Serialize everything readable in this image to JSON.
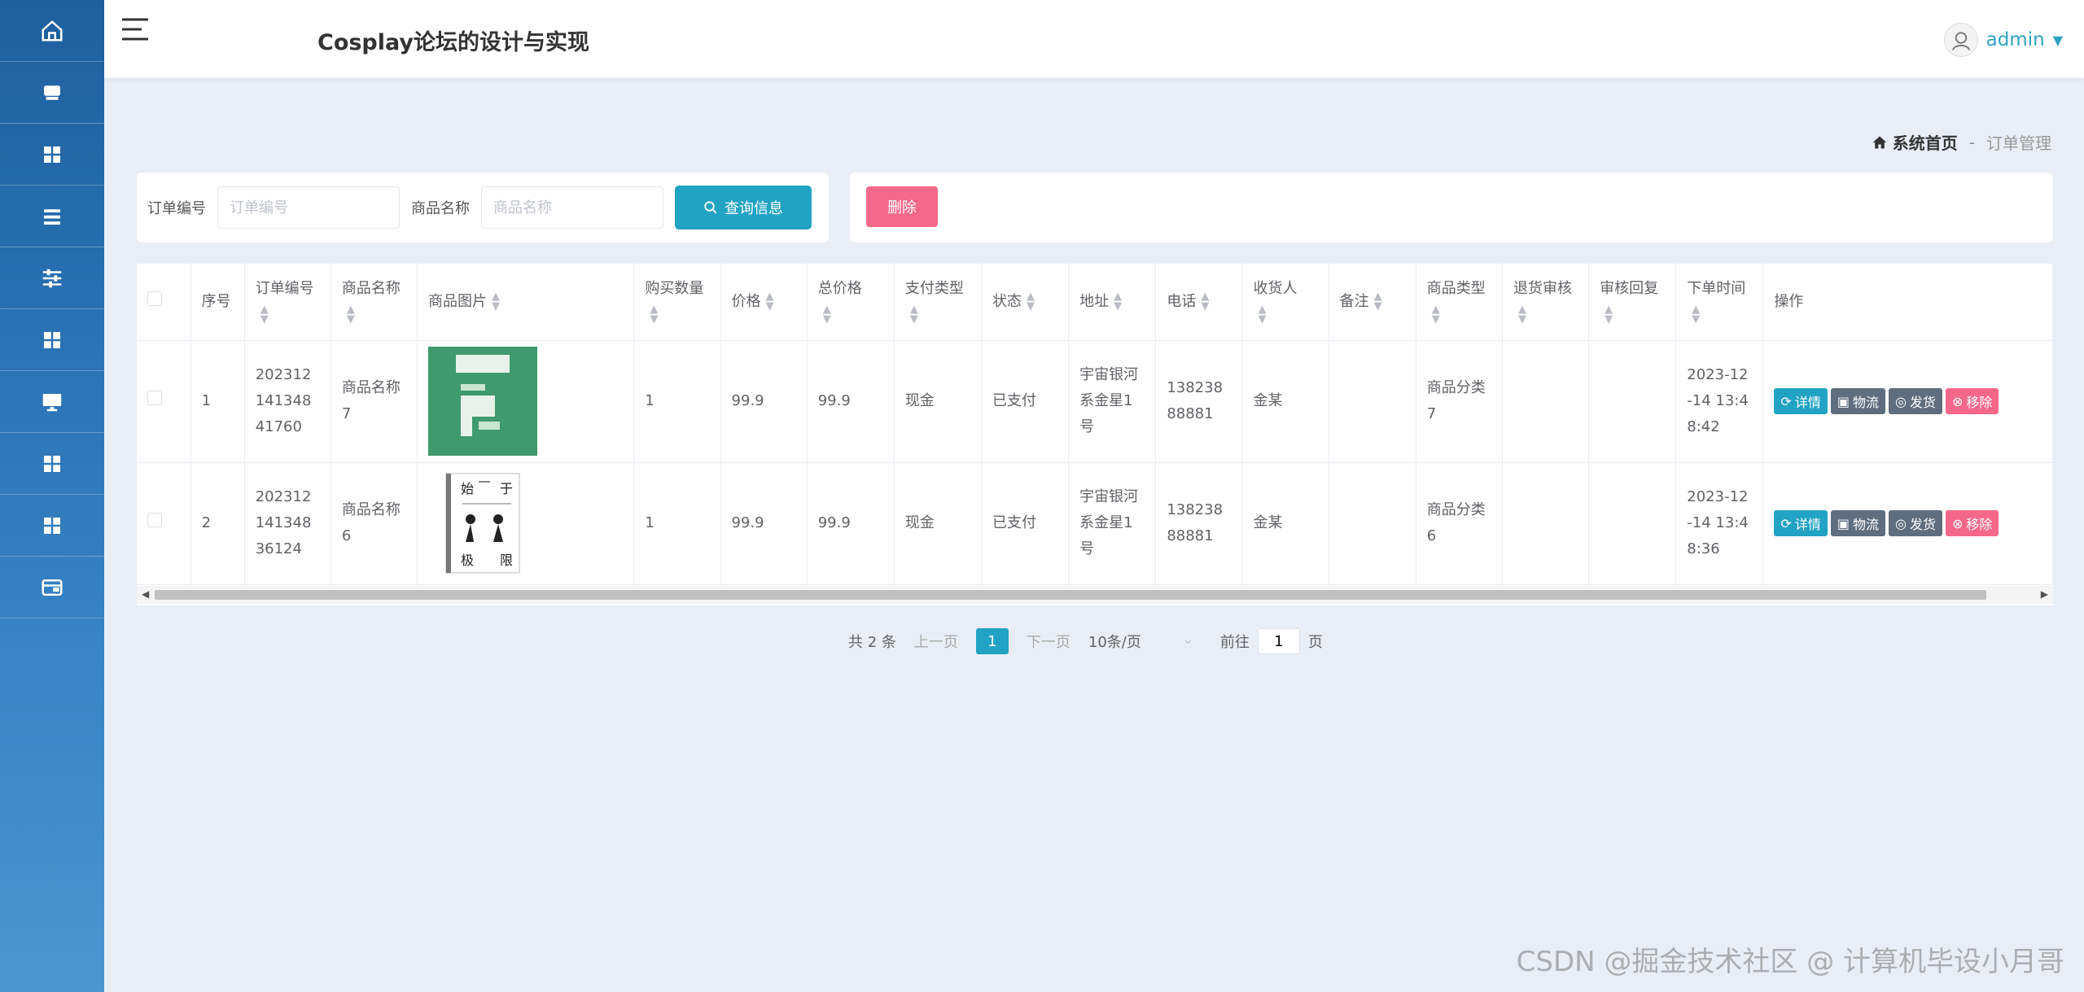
{
  "header": {
    "title": "Cosplay论坛的设计与实现",
    "user": "admin"
  },
  "sidebar": {
    "icons": [
      "home-icon",
      "store-icon",
      "grid-icon",
      "list-icon",
      "sliders-icon",
      "grid-icon",
      "monitor-icon",
      "grid-icon",
      "grid-icon",
      "wallet-icon"
    ]
  },
  "breadcrumb": {
    "home": "系统首页",
    "separator": "-",
    "current": "订单管理"
  },
  "search": {
    "order_no_label": "订单编号",
    "order_no_placeholder": "订单编号",
    "product_name_label": "商品名称",
    "product_name_placeholder": "商品名称",
    "search_button": "查询信息"
  },
  "actions": {
    "delete_button": "删除"
  },
  "table": {
    "columns": [
      "序号",
      "订单编号",
      "商品名称",
      "商品图片",
      "购买数量",
      "价格",
      "总价格",
      "支付类型",
      "状态",
      "地址",
      "电话",
      "收货人",
      "备注",
      "商品类型",
      "退货审核",
      "审核回复",
      "下单时间",
      "操作"
    ],
    "rows": [
      {
        "index": "1",
        "order_no": "20231214134841760",
        "product_name": "商品名称7",
        "quantity": "1",
        "price": "99.9",
        "total": "99.9",
        "pay_type": "现金",
        "status": "已支付",
        "address": "宇宙银河系金星1号",
        "phone": "13823888881",
        "receiver": "金某",
        "remark": "",
        "category": "商品分类7",
        "return_review": "",
        "review_reply": "",
        "order_time": "2023-12-14 13:48:42"
      },
      {
        "index": "2",
        "order_no": "20231214134836124",
        "product_name": "商品名称6",
        "quantity": "1",
        "price": "99.9",
        "total": "99.9",
        "pay_type": "现金",
        "status": "已支付",
        "address": "宇宙银河系金星1号",
        "phone": "13823888881",
        "receiver": "金某",
        "remark": "",
        "category": "商品分类6",
        "return_review": "",
        "review_reply": "",
        "order_time": "2023-12-14 13:48:36"
      }
    ],
    "ops": {
      "detail": "详情",
      "logistics": "物流",
      "ship": "发货",
      "remove": "移除"
    },
    "image2_text": [
      "始",
      "于",
      "极",
      "限"
    ]
  },
  "pagination": {
    "total": "共 2 条",
    "prev": "上一页",
    "page": "1",
    "next": "下一页",
    "page_size": "10条/页",
    "goto": "前往",
    "goto_value": "1",
    "goto_suffix": "页"
  },
  "watermark": "CSDN @掘金技术社区 @ 计算机毕设小月哥",
  "colors": {
    "primary": "#22a3c4",
    "danger": "#f5688a",
    "dark_button": "#5e6e7f",
    "sidebar": "#2a73b5"
  }
}
